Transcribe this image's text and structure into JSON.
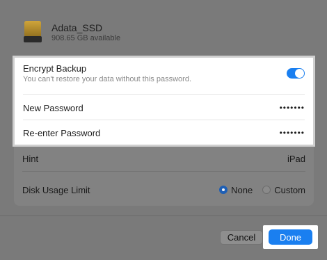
{
  "drive": {
    "name": "Adata_SSD",
    "available": "908.65 GB available"
  },
  "encrypt": {
    "title": "Encrypt Backup",
    "subtitle": "You can't restore your data without this password.",
    "enabled": true
  },
  "new_password": {
    "label": "New Password",
    "value": "•••••••"
  },
  "reenter_password": {
    "label": "Re-enter Password",
    "value": "•••••••"
  },
  "hint": {
    "label": "Hint",
    "value": "iPad"
  },
  "disk_usage": {
    "label": "Disk Usage Limit",
    "options": [
      "None",
      "Custom"
    ],
    "selected": "None"
  },
  "buttons": {
    "cancel": "Cancel",
    "done": "Done"
  },
  "colors": {
    "accent": "#1a7ff0"
  }
}
